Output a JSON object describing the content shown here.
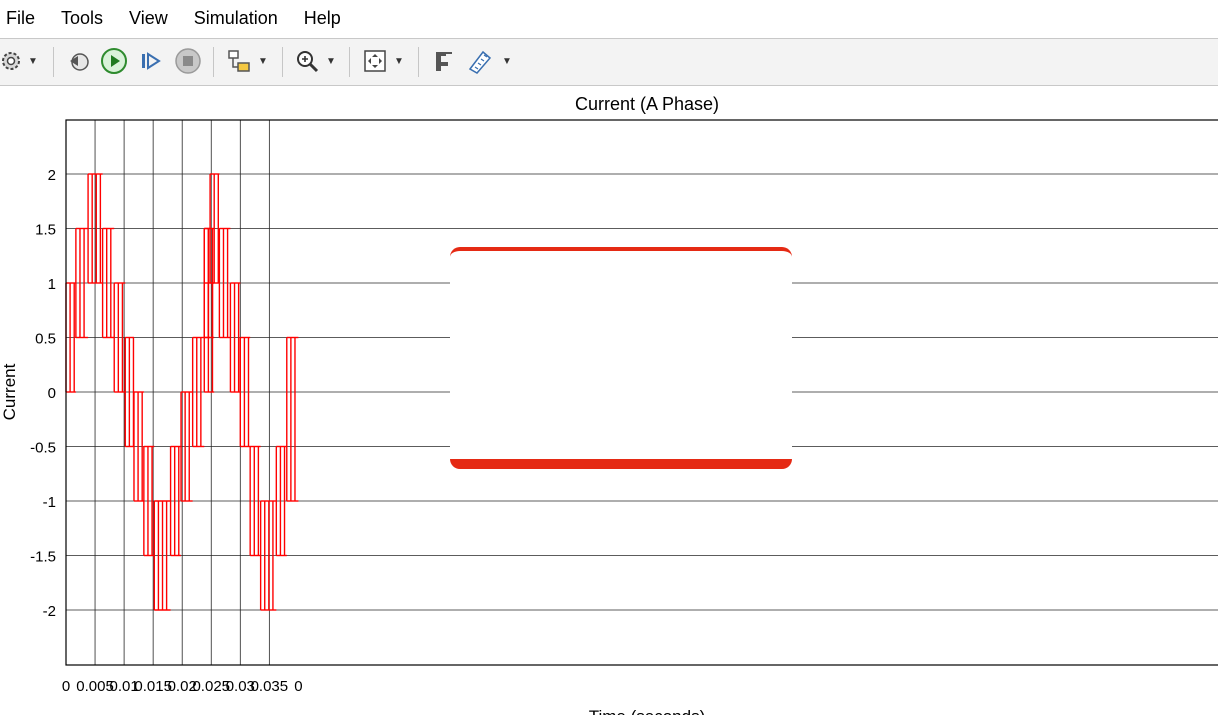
{
  "menu": [
    "File",
    "Tools",
    "View",
    "Simulation",
    "Help"
  ],
  "toolbar_icons": [
    "settings-icon",
    "step-back-icon",
    "run-icon",
    "step-forward-icon",
    "stop-icon",
    "highlight-block-icon",
    "zoom-in-icon",
    "fit-to-view-icon",
    "cursor-measure-icon",
    "signal-stats-icon"
  ],
  "colors": {
    "trace": "#ff0000",
    "overlay_border": "#e52a14",
    "toolbar_bg": "#f3f3f3"
  },
  "chart_data": {
    "type": "line",
    "title": "Current (A Phase)",
    "xlabel": "Time (seconds)",
    "ylabel": "Current",
    "xlim": [
      0,
      0.04
    ],
    "ylim": [
      -2.5,
      2.5
    ],
    "xticks": [
      "0",
      "0.005",
      "0.01",
      "0.015",
      "0.02",
      "0.025",
      "0.03",
      "0.035",
      "0"
    ],
    "yticks": [
      "2",
      "1.5",
      "1",
      "0.5",
      "0",
      "-0.5",
      "-1",
      "-1.5",
      "-2"
    ],
    "grid": true,
    "series": [
      {
        "color": "#ff0000",
        "segments": [
          {
            "t0": 0.0,
            "t1": 0.0017,
            "lo": 0,
            "hi": 1
          },
          {
            "t0": 0.0017,
            "t1": 0.0038,
            "lo": 0.5,
            "hi": 1.5
          },
          {
            "t0": 0.0038,
            "t1": 0.0063,
            "lo": 1,
            "hi": 2
          },
          {
            "t0": 0.0063,
            "t1": 0.0083,
            "lo": 0.5,
            "hi": 1.5
          },
          {
            "t0": 0.0083,
            "t1": 0.0102,
            "lo": 0,
            "hi": 1
          },
          {
            "t0": 0.0102,
            "t1": 0.0117,
            "lo": -0.5,
            "hi": 0.5
          },
          {
            "t0": 0.0117,
            "t1": 0.0134,
            "lo": -1,
            "hi": 0
          },
          {
            "t0": 0.0134,
            "t1": 0.0152,
            "lo": -1.5,
            "hi": -0.5
          },
          {
            "t0": 0.0152,
            "t1": 0.018,
            "lo": -2,
            "hi": -1
          },
          {
            "t0": 0.018,
            "t1": 0.0198,
            "lo": -1.5,
            "hi": -0.5
          },
          {
            "t0": 0.0198,
            "t1": 0.0218,
            "lo": -1,
            "hi": 0
          },
          {
            "t0": 0.0218,
            "t1": 0.0238,
            "lo": -0.5,
            "hi": 0.5
          },
          {
            "t0": 0.0238,
            "t1": 0.0255,
            "lo": 0.5,
            "hi": 1.5
          },
          {
            "t0": 0.0238,
            "t1": 0.0255,
            "lo": 0,
            "hi": 1
          },
          {
            "t0": 0.0238,
            "t1": 0.0248,
            "lo": 0.5,
            "hi": 1.5
          },
          {
            "t0": 0.0248,
            "t1": 0.0264,
            "lo": 1,
            "hi": 2
          },
          {
            "t0": 0.0264,
            "t1": 0.0283,
            "lo": 0.5,
            "hi": 1.5
          },
          {
            "t0": 0.0283,
            "t1": 0.03,
            "lo": 0,
            "hi": 1
          },
          {
            "t0": 0.03,
            "t1": 0.0317,
            "lo": -0.5,
            "hi": 0.5
          },
          {
            "t0": 0.0317,
            "t1": 0.0335,
            "lo": -1.5,
            "hi": -0.5
          },
          {
            "t0": 0.0335,
            "t1": 0.0362,
            "lo": -2,
            "hi": -1
          },
          {
            "t0": 0.0362,
            "t1": 0.038,
            "lo": -1.5,
            "hi": -0.5
          },
          {
            "t0": 0.038,
            "t1": 0.04,
            "lo": -1,
            "hi": 0.5
          }
        ]
      }
    ]
  }
}
